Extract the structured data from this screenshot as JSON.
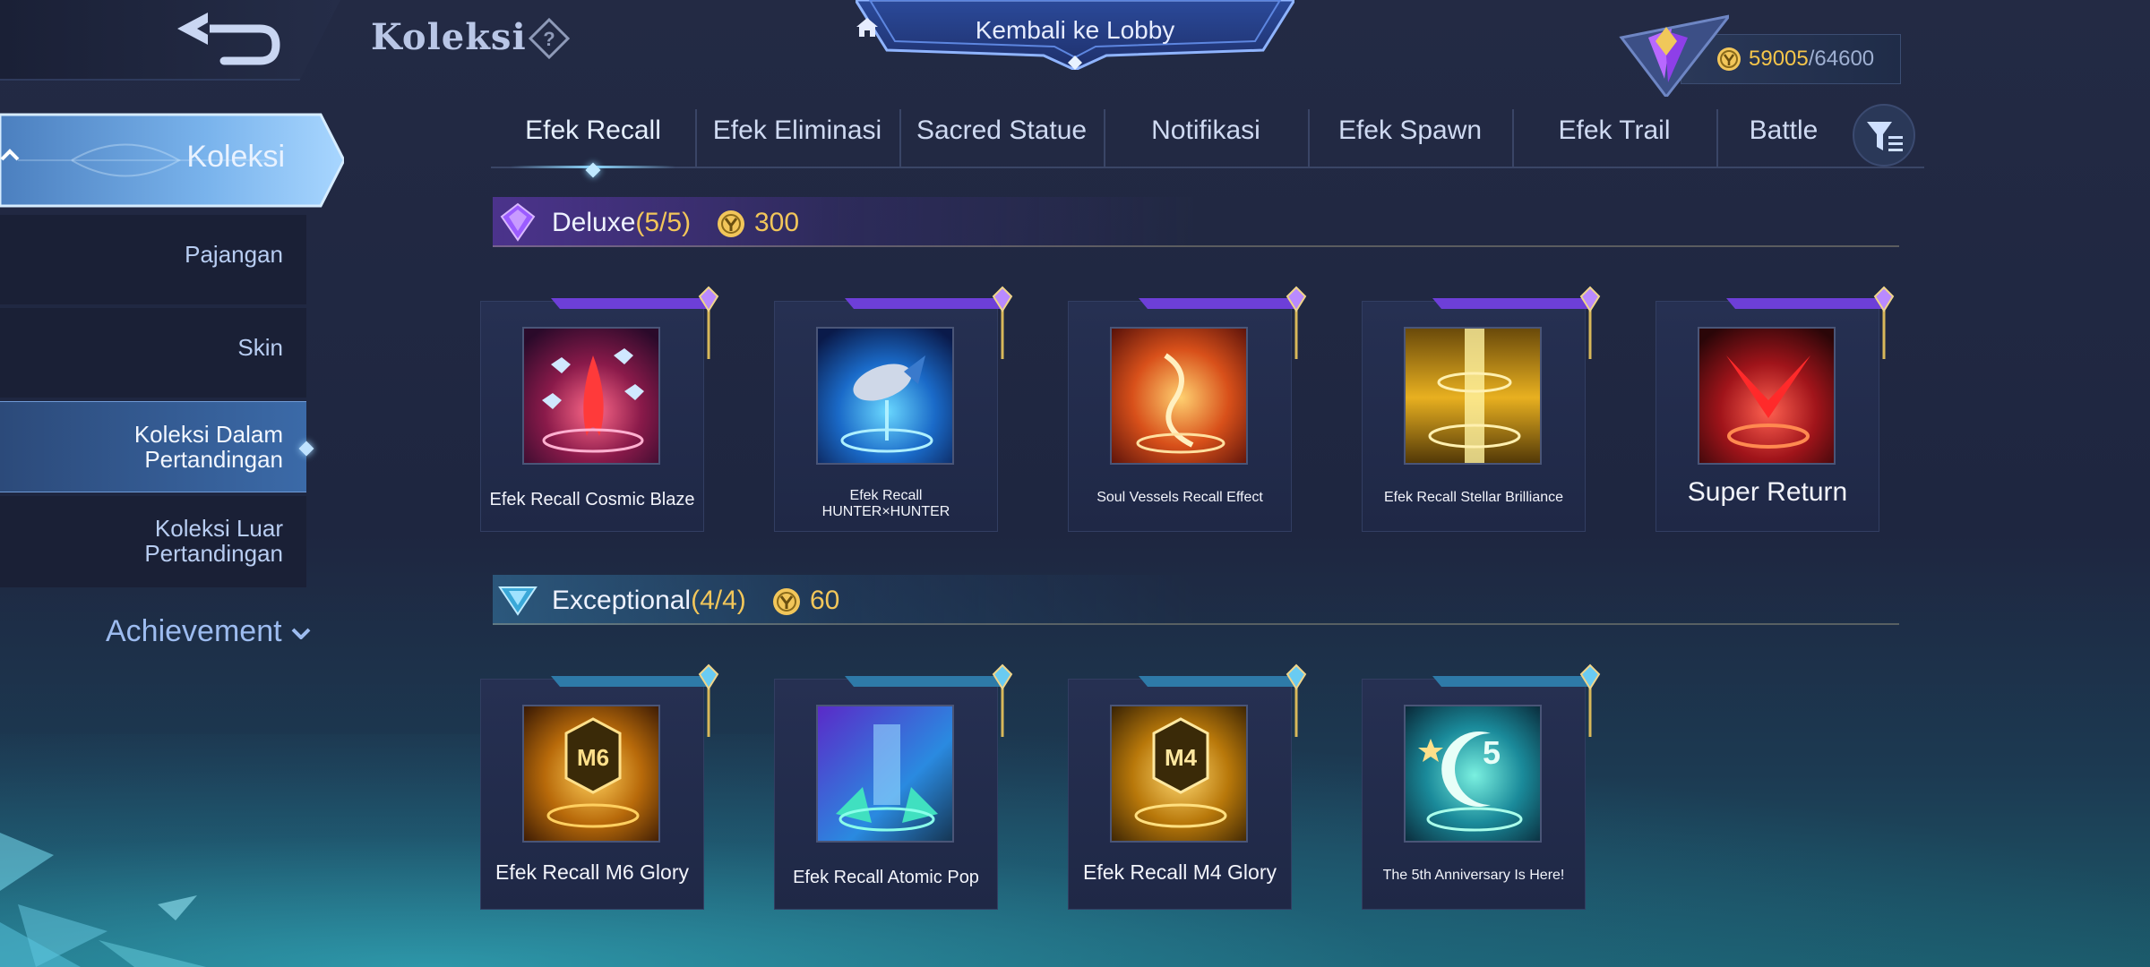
{
  "header": {
    "title": "Koleksi",
    "lobby_label": "Kembali ke Lobby",
    "currency_current": "59005",
    "currency_max": "/64600",
    "icons": {
      "back": "back-arrow-icon",
      "help": "help-icon",
      "home": "home-icon",
      "coin": "coin-icon"
    }
  },
  "sidebar": {
    "main": "Koleksi",
    "items": [
      {
        "label": "Pajangan"
      },
      {
        "label": "Skin"
      },
      {
        "label": "Koleksi Dalam Pertandingan",
        "active": true
      },
      {
        "label": "Koleksi Luar Pertandingan"
      }
    ],
    "achievement": "Achievement"
  },
  "tabs": [
    {
      "label": "Efek Recall",
      "active": true
    },
    {
      "label": "Efek Eliminasi"
    },
    {
      "label": "Sacred Statue"
    },
    {
      "label": "Notifikasi"
    },
    {
      "label": "Efek Spawn"
    },
    {
      "label": "Efek Trail"
    },
    {
      "label": "Battle"
    }
  ],
  "sections": [
    {
      "name": "Deluxe",
      "count": "(5/5)",
      "price": "300",
      "accent": "#9b5cff",
      "items": [
        {
          "name": "Efek Recall Cosmic Blaze"
        },
        {
          "name_line1": "Efek Recall",
          "name_line2": "HUNTER×HUNTER"
        },
        {
          "name": "Soul Vessels Recall Effect"
        },
        {
          "name": "Efek Recall Stellar Brilliance"
        },
        {
          "name": "Super Return"
        }
      ]
    },
    {
      "name": "Exceptional",
      "count": "(4/4)",
      "price": "60",
      "accent": "#4fc8e8",
      "items": [
        {
          "name": "Efek Recall M6 Glory"
        },
        {
          "name": "Efek Recall Atomic Pop"
        },
        {
          "name": "Efek Recall M4 Glory"
        },
        {
          "name": "The 5th Anniversary Is Here!"
        }
      ]
    }
  ],
  "colors": {
    "gold": "#f2c65a",
    "bg": "#232a44",
    "active_nav": "#3b6aa8"
  }
}
